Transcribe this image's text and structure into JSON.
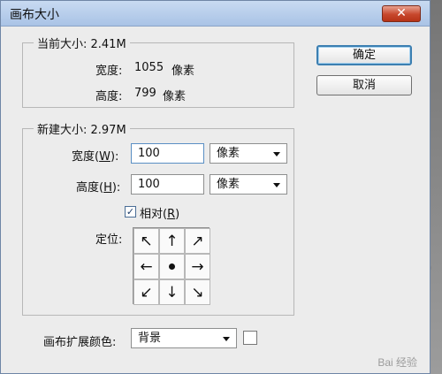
{
  "window": {
    "title": "画布大小",
    "close_symbol": "✕"
  },
  "current_size": {
    "label": "当前大小: 2.41M",
    "width_label": "宽度:",
    "width_value": "1055",
    "width_unit": "像素",
    "height_label": "高度:",
    "height_value": "799",
    "height_unit": "像素"
  },
  "buttons": {
    "ok": "确定",
    "cancel": "取消"
  },
  "new_size": {
    "label": "新建大小: 2.97M",
    "width_label_prefix": "宽度(",
    "width_label_key": "W",
    "width_label_suffix": "):",
    "width_value": "100",
    "width_unit": "像素",
    "height_label_prefix": "高度(",
    "height_label_key": "H",
    "height_label_suffix": "):",
    "height_value": "100",
    "height_unit": "像素",
    "relative_label_prefix": "相对(",
    "relative_label_key": "R",
    "relative_label_suffix": ")",
    "relative_checked": true,
    "anchor_label": "定位:",
    "anchor_cells": [
      "↖",
      "↑",
      "↗",
      "←",
      "",
      "→",
      "↙",
      "↓",
      "↘"
    ]
  },
  "extension_color": {
    "label": "画布扩展颜色:",
    "value": "背景",
    "swatch_color": "#ffffff"
  },
  "watermark": "Bai 经验"
}
